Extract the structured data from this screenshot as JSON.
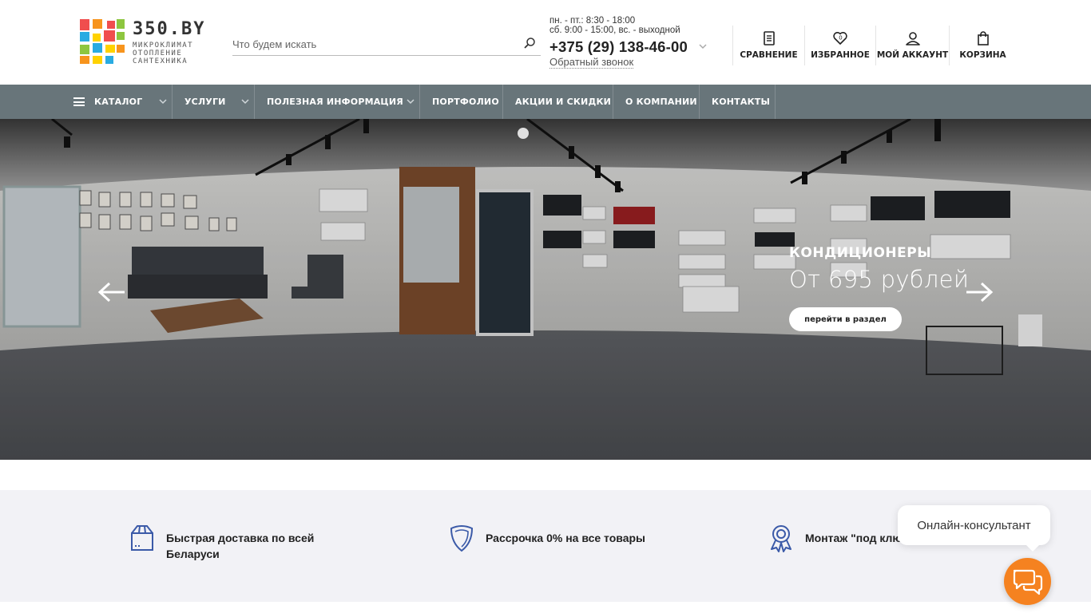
{
  "brand": {
    "name": "350.BY",
    "tagline": [
      "МИКРОКЛИМАТ",
      "ОТОПЛЕНИЕ",
      "САНТЕХНИКА"
    ]
  },
  "search": {
    "placeholder": "Что будем искать"
  },
  "contact": {
    "hours_weekdays": "пн. - пт.: 8:30 - 18:00",
    "hours_weekend": "сб. 9:00 - 15:00, вс. - выходной",
    "phone": "+375 (29) 138-46-00",
    "callback": "Обратный звонок"
  },
  "header_actions": [
    {
      "label": "СРАВНЕНИЕ",
      "icon": "compare-icon"
    },
    {
      "label": "ИЗБРАННОЕ",
      "icon": "heart-icon"
    },
    {
      "label": "МОЙ АККАУНТ",
      "icon": "user-icon"
    },
    {
      "label": "КОРЗИНА",
      "icon": "bag-icon"
    }
  ],
  "nav": {
    "catalog": "КАТАЛОГ",
    "items": [
      "УСЛУГИ",
      "ПОЛЕЗНАЯ ИНФОРМАЦИЯ",
      "ПОРТФОЛИО",
      "АКЦИИ И СКИДКИ",
      "О КОМПАНИИ",
      "КОНТАКТЫ"
    ]
  },
  "hero": {
    "title": "КОНДИЦИОНЕРЫ",
    "subtitle": "От 695 рублей",
    "button": "перейти в раздел"
  },
  "features": [
    {
      "text": "Быстрая доставка по всей Беларуси",
      "icon": "box-icon"
    },
    {
      "text": "Рассрочка 0% на все товары",
      "icon": "shield-icon"
    },
    {
      "text": "Монтаж \"под ключ\"",
      "icon": "award-icon"
    }
  ],
  "chat": {
    "label": "Онлайн-консультант"
  },
  "colors": {
    "nav_bg": "#68757a",
    "accent_orange": "#f58220",
    "feature_icon": "#3b5aa8",
    "features_bg": "#f2f2f6"
  }
}
